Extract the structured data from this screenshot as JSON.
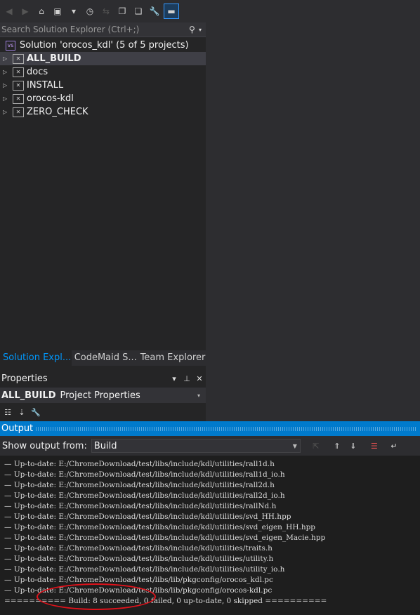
{
  "solution_explorer": {
    "search_placeholder": "Search Solution Explorer (Ctrl+;)",
    "solution_label": "Solution 'orocos_kdl' (5 of 5 projects)",
    "projects": [
      {
        "label": "ALL_BUILD",
        "selected": true
      },
      {
        "label": "docs",
        "selected": false
      },
      {
        "label": "INSTALL",
        "selected": false
      },
      {
        "label": "orocos-kdl",
        "selected": false
      },
      {
        "label": "ZERO_CHECK",
        "selected": false
      }
    ]
  },
  "tabs": [
    "Solution Expl...",
    "CodeMaid S...",
    "Team Explorer"
  ],
  "properties": {
    "title": "Properties",
    "object_name": "ALL_BUILD",
    "object_type": "Project Properties"
  },
  "output": {
    "title": "Output",
    "show_from_label": "Show output from:",
    "source": "Build",
    "lines": [
      "— Up-to-date: E:/ChromeDownload/test/libs/include/kdl/utilities/rall1d.h",
      "— Up-to-date: E:/ChromeDownload/test/libs/include/kdl/utilities/rall1d_io.h",
      "— Up-to-date: E:/ChromeDownload/test/libs/include/kdl/utilities/rall2d.h",
      "— Up-to-date: E:/ChromeDownload/test/libs/include/kdl/utilities/rall2d_io.h",
      "— Up-to-date: E:/ChromeDownload/test/libs/include/kdl/utilities/rallNd.h",
      "— Up-to-date: E:/ChromeDownload/test/libs/include/kdl/utilities/svd_HH.hpp",
      "— Up-to-date: E:/ChromeDownload/test/libs/include/kdl/utilities/svd_eigen_HH.hpp",
      "— Up-to-date: E:/ChromeDownload/test/libs/include/kdl/utilities/svd_eigen_Macie.hpp",
      "— Up-to-date: E:/ChromeDownload/test/libs/include/kdl/utilities/traits.h",
      "— Up-to-date: E:/ChromeDownload/test/libs/include/kdl/utilities/utility.h",
      "— Up-to-date: E:/ChromeDownload/test/libs/include/kdl/utilities/utility_io.h",
      "— Up-to-date: E:/ChromeDownload/test/libs/lib/pkgconfig/orocos_kdl.pc",
      "— Up-to-date: E:/ChromeDownload/test/libs/lib/pkgconfig/orocos-kdl.pc"
    ],
    "summary": "========== Build: 8 succeeded, 0 failed, 0 up-to-date, 0 skipped =========="
  },
  "colors": {
    "accent": "#007acc",
    "highlight_ring": "#e0121b"
  }
}
